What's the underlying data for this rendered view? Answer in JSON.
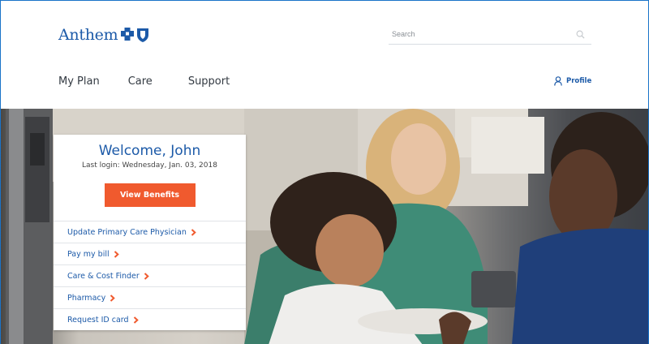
{
  "header": {
    "logo_text": "Anthem",
    "search": {
      "placeholder": "Search"
    },
    "nav": [
      {
        "label": "My Plan"
      },
      {
        "label": "Care"
      },
      {
        "label": "Support"
      }
    ],
    "profile_label": "Profile"
  },
  "welcome_card": {
    "greeting": "Welcome, John",
    "last_login": "Last login: Wednesday, Jan. 03, 2018",
    "view_benefits_label": "View Benefits",
    "links": [
      {
        "label": "Update Primary Care Physician"
      },
      {
        "label": "Pay my bill"
      },
      {
        "label": "Care & Cost Finder"
      },
      {
        "label": "Pharmacy"
      },
      {
        "label": "Request ID card"
      }
    ]
  },
  "colors": {
    "brand_blue": "#1c5aa8",
    "cta_orange": "#f05a2e",
    "link_chevron": "#f05a2e"
  },
  "icons": [
    "anthem-cross-shield-logo-icon",
    "search-icon",
    "user-icon",
    "chevron-right-icon"
  ]
}
